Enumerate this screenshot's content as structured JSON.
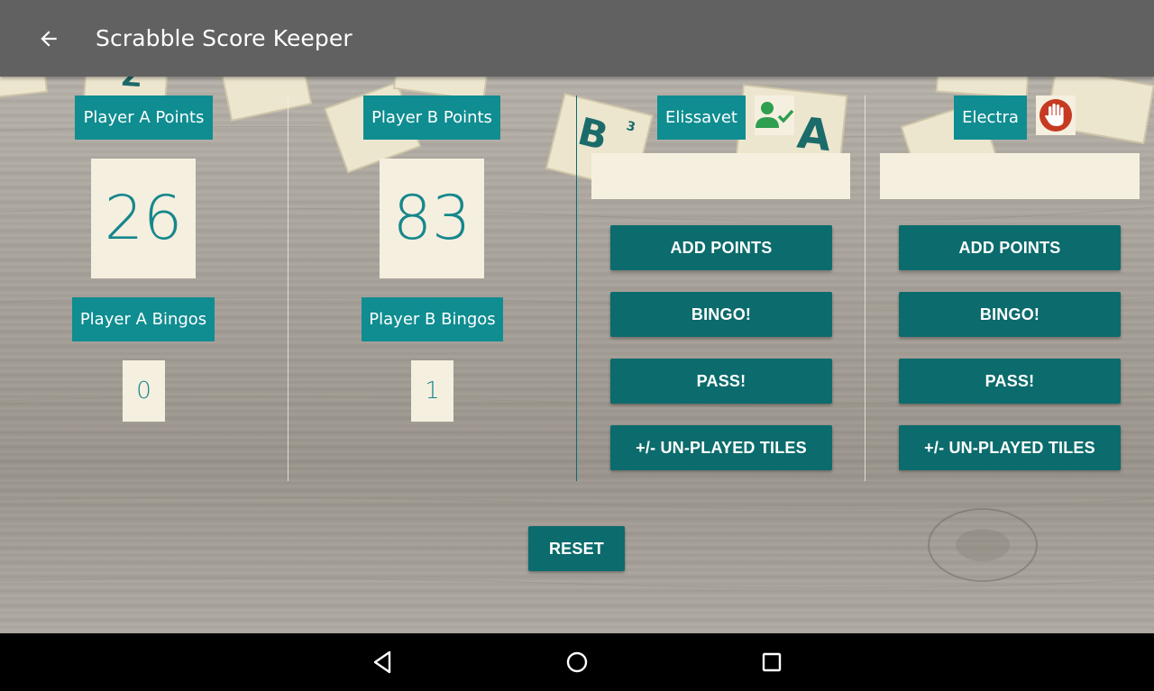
{
  "app_bar": {
    "title": "Scrabble Score Keeper",
    "back_icon": "arrow-left-icon"
  },
  "player_a": {
    "points_label": "Player A Points",
    "points": "26",
    "bingos_label": "Player A Bingos",
    "bingos": "0"
  },
  "player_b": {
    "points_label": "Player B Points",
    "points": "83",
    "bingos_label": "Player B Bingos",
    "bingos": "1"
  },
  "panel_1": {
    "name": "Elissavet",
    "status_icon": "person-check-icon",
    "input_value": "",
    "add_points": "ADD POINTS",
    "bingo": "BINGO!",
    "pass": "PASS!",
    "unplayed": "+/- UN-PLAYED TILES"
  },
  "panel_2": {
    "name": "Electra",
    "status_icon": "stop-hand-icon",
    "input_value": "",
    "add_points": "ADD POINTS",
    "bingo": "BINGO!",
    "pass": "PASS!",
    "unplayed": "+/- UN-PLAYED TILES"
  },
  "reset_label": "RESET",
  "colors": {
    "app_bar": "#616161",
    "label_teal": "#0f8d91",
    "button_teal": "#0c6b6c",
    "score_bg": "#f5efdf",
    "score_text": "#16878c",
    "check_green": "#2e9e4f",
    "stop_red": "#c63a22"
  },
  "nav_bar": {
    "back": "nav-back-icon",
    "home": "nav-home-icon",
    "recents": "nav-recents-icon"
  }
}
